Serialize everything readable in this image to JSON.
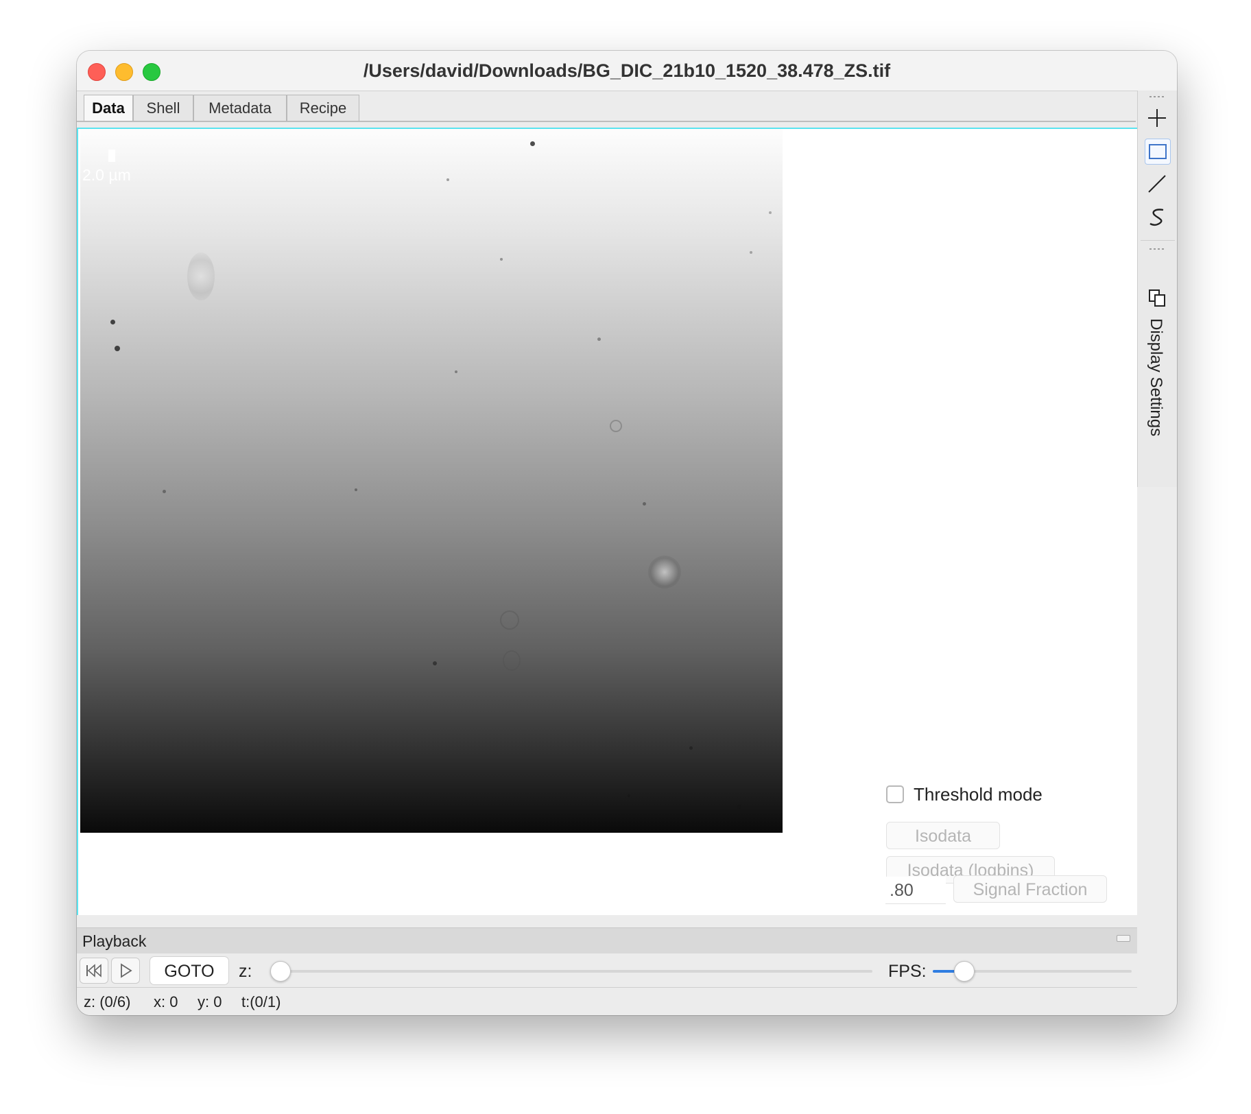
{
  "window": {
    "title": "/Users/david/Downloads/BG_DIC_21b10_1520_38.478_ZS.tif"
  },
  "tabs": [
    {
      "label": "Data",
      "active": true
    },
    {
      "label": "Shell",
      "active": false
    },
    {
      "label": "Metadata",
      "active": false
    },
    {
      "label": "Recipe",
      "active": false
    }
  ],
  "image": {
    "scale_label": "2.0 µm"
  },
  "threshold": {
    "mode_label": "Threshold mode",
    "checked": false,
    "isodata_label": "Isodata",
    "isodata_logbins_label": "Isodata (logbins)",
    "fraction_value": ".80",
    "signal_fraction_label": "Signal Fraction"
  },
  "toolbar": {
    "tools": [
      "crosshair-icon",
      "rectangle-select-icon",
      "line-icon",
      "curve-icon"
    ],
    "selected_tool": "rectangle-select-icon",
    "display_settings_label": "Display Settings"
  },
  "playback": {
    "title": "Playback",
    "goto_label": "GOTO",
    "z_label": "z:",
    "fps_label": "FPS:",
    "z_fraction": 0.0,
    "fps_fraction": 0.12
  },
  "status": {
    "z": "z: (0/6)",
    "x": "x: 0",
    "y": "y: 0",
    "t": "t:(0/1)"
  },
  "colors": {
    "accent": "#2f7de1",
    "view_border": "#59e4f0",
    "close": "#fe5f57",
    "minimize": "#febc2e",
    "maximize": "#28c840"
  }
}
